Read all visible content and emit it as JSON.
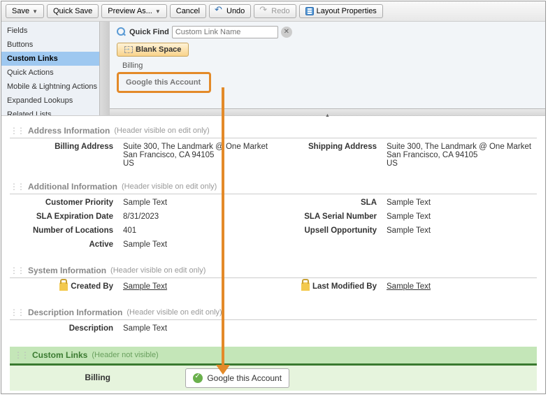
{
  "toolbar": {
    "save": "Save",
    "quick_save": "Quick Save",
    "preview_as": "Preview As...",
    "cancel": "Cancel",
    "undo": "Undo",
    "redo": "Redo",
    "layout_properties": "Layout Properties"
  },
  "palette": {
    "categories": [
      "Fields",
      "Buttons",
      "Custom Links",
      "Quick Actions",
      "Mobile & Lightning Actions",
      "Expanded Lookups",
      "Related Lists"
    ],
    "quick_find_label": "Quick Find",
    "quick_find_placeholder": "Custom Link Name",
    "blank_space": "Blank Space",
    "items": [
      "Billing",
      "Google this Account"
    ]
  },
  "sections": {
    "address": {
      "title": "Address Information",
      "hint": "(Header visible on edit only)",
      "billing_label": "Billing Address",
      "billing_line1": "Suite 300, The Landmark @ One Market",
      "billing_line2": "San Francisco, CA 94105",
      "billing_line3": "US",
      "shipping_label": "Shipping Address",
      "shipping_line1": "Suite 300, The Landmark @ One Market",
      "shipping_line2": "San Francisco, CA 94105",
      "shipping_line3": "US"
    },
    "additional": {
      "title": "Additional Information",
      "hint": "(Header visible on edit only)",
      "customer_priority_label": "Customer Priority",
      "customer_priority_value": "Sample Text",
      "sla_expiration_label": "SLA Expiration Date",
      "sla_expiration_value": "8/31/2023",
      "num_locations_label": "Number of Locations",
      "num_locations_value": "401",
      "active_label": "Active",
      "active_value": "Sample Text",
      "sla_label": "SLA",
      "sla_value": "Sample Text",
      "sla_serial_label": "SLA Serial Number",
      "sla_serial_value": "Sample Text",
      "upsell_label": "Upsell Opportunity",
      "upsell_value": "Sample Text"
    },
    "system": {
      "title": "System Information",
      "hint": "(Header visible on edit only)",
      "created_by_label": "Created By",
      "created_by_value": "Sample Text",
      "modified_by_label": "Last Modified By",
      "modified_by_value": "Sample Text"
    },
    "description": {
      "title": "Description Information",
      "hint": "(Header visible on edit only)",
      "description_label": "Description",
      "description_value": "Sample Text"
    },
    "custom_links": {
      "title": "Custom Links",
      "hint": "(Header not visible)",
      "col1": "Billing",
      "drop_item": "Google this Account"
    }
  }
}
